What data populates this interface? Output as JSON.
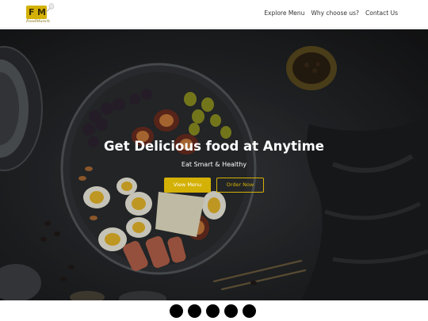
{
  "brand": {
    "logo_letters": "FM",
    "logo_text": "FoodMunch",
    "accent": "#d4b106"
  },
  "nav": {
    "items": [
      "Explore Menu",
      "Why choose us?",
      "Contact Us"
    ]
  },
  "hero": {
    "title": "Get Delicious food at Anytime",
    "subtitle": "Eat Smart & Healthy",
    "primary_button": "View Menu",
    "secondary_button": "Order Now"
  },
  "carousel": {
    "dot_count": 5,
    "dot_color": "#000000"
  }
}
